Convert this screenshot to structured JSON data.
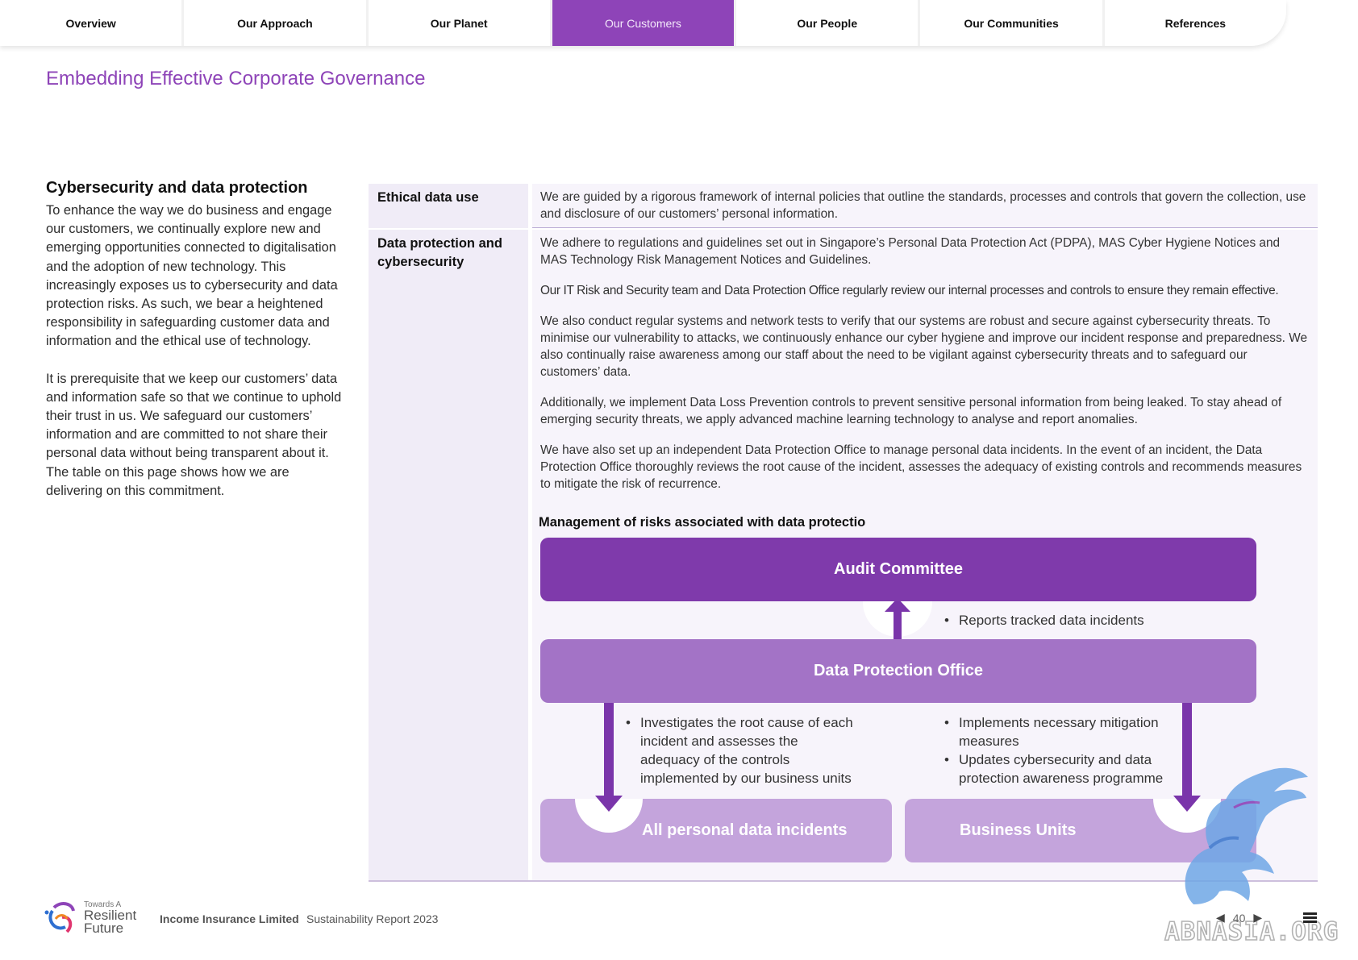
{
  "nav": {
    "tabs": [
      {
        "label": "Overview",
        "active": false
      },
      {
        "label": "Our Approach",
        "active": false
      },
      {
        "label": "Our Planet",
        "active": false
      },
      {
        "label": "Our Customers",
        "active": true
      },
      {
        "label": "Our People",
        "active": false
      },
      {
        "label": "Our Communities",
        "active": false
      },
      {
        "label": "References",
        "active": false
      }
    ]
  },
  "page_title": "Embedding Effective Corporate Governance",
  "left": {
    "title": "Cybersecurity and data protection",
    "paragraphs": [
      "To enhance the way we do business and engage our customers, we continually explore new and emerging opportunities connected to digitalisation and the adoption of new technology. This increasingly exposes us to cybersecurity and data protection risks. As such, we bear a heightened responsibility in safeguarding customer data and information and the ethical use of technology.",
      "It is prerequisite that we keep our customers’ data and information safe so that we continue to uphold their trust in us. We safeguard our customers’ information and are committed to not share their personal data without being transparent about it. The table on this page shows how we are delivering on this commitment."
    ]
  },
  "table": {
    "rows": [
      {
        "header": "Ethical data use",
        "paragraphs": [
          "We are guided by a rigorous framework of internal policies that outline the standards, processes and controls that govern the collection, use and disclosure of our customers’ personal information."
        ]
      },
      {
        "header": "Data protection and cybersecurity",
        "paragraphs": [
          "We adhere to regulations and guidelines set out in Singapore’s Personal Data Protection Act (PDPA), MAS Cyber Hygiene Notices and MAS Technology Risk Management Notices and Guidelines.",
          "Our IT Risk and Security team and Data Protection Office regularly review our internal processes and controls to ensure they remain effective.",
          "We also conduct regular systems and network tests to verify that our systems are robust and secure against cybersecurity threats. To minimise our vulnerability to attacks, we continuously enhance our cyber hygiene and improve our incident response and preparedness. We also continually raise awareness among our staff about the need to be vigilant against cybersecurity threats and to safeguard our customers’ data.",
          "Additionally, we implement Data Loss Prevention controls to prevent sensitive personal information from being leaked. To stay ahead of emerging security threats, we apply advanced machine learning technology to analyse and report anomalies.",
          "We have also set up an independent Data Protection Office to manage personal data incidents. In the event of an incident, the Data Protection Office thoroughly reviews the root cause of the incident, assesses the adequacy of existing controls and recommends measures to mitigate the risk of recurrence."
        ]
      }
    ]
  },
  "diagram": {
    "title": "Management of risks associated with data protectio",
    "audit_committee": "Audit Committee",
    "audit_bullet": "Reports tracked data incidents",
    "dpo": "Data Protection Office",
    "left_bullet": "Investigates the root cause of each incident and assesses the adequacy of the controls implemented by our business units",
    "right_bullets": [
      "Implements necessary mitigation measures",
      "Updates cybersecurity and data protection awareness programme"
    ],
    "incidents_box": "All personal data incidents",
    "business_box": "Business Units",
    "colors": {
      "audit": "#7f3aab",
      "dpo": "#a373c6",
      "lower": "#c4a4dc",
      "arrow": "#7a35aa"
    }
  },
  "footer": {
    "logo_small": "Towards A",
    "logo_line1": "Resilient",
    "logo_line2": "Future",
    "company": "Income Insurance Limited",
    "report": "Sustainability Report 2023",
    "page_number": "40",
    "icons": [
      "prev-arrow-icon",
      "next-arrow-icon",
      "menu-icon"
    ]
  },
  "watermark": {
    "text": "ABNASIA.ORG"
  },
  "accent_color": "#8e44b8"
}
